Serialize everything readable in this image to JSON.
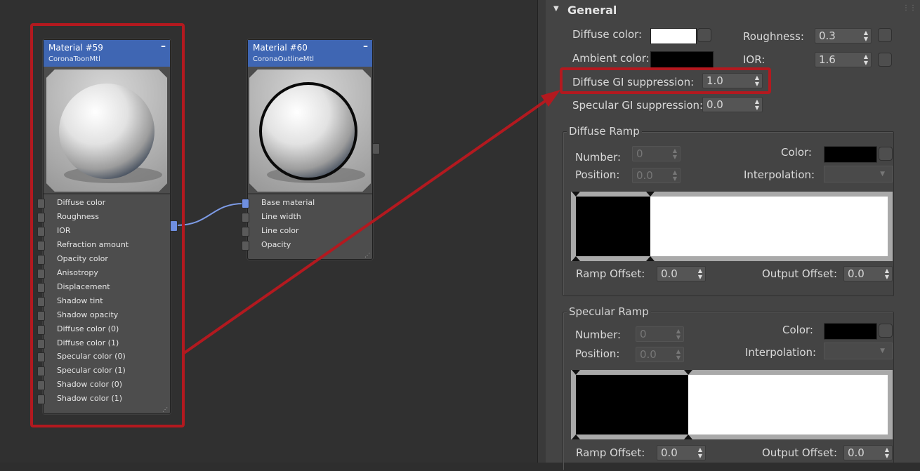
{
  "graph": {
    "nodes": [
      {
        "title": "Material #59",
        "subtitle": "CoronaToonMtl",
        "collapse_glyph": "–",
        "slots": [
          "Diffuse color",
          "Roughness",
          "IOR",
          "Refraction amount",
          "Opacity color",
          "Anisotropy",
          "Displacement",
          "Shadow tint",
          "Shadow opacity",
          "Diffuse color (0)",
          "Diffuse color (1)",
          "Specular color (0)",
          "Specular color (1)",
          "Shadow color (0)",
          "Shadow color (1)"
        ]
      },
      {
        "title": "Material #60",
        "subtitle": "CoronaOutlineMtl",
        "collapse_glyph": "–",
        "slots": [
          "Base material",
          "Line width",
          "Line color",
          "Opacity"
        ]
      }
    ]
  },
  "panel": {
    "rollout_title": "General",
    "diffuse_color_label": "Diffuse color:",
    "ambient_color_label": "Ambient color:",
    "roughness_label": "Roughness:",
    "roughness_value": "0.3",
    "ior_label": "IOR:",
    "ior_value": "1.6",
    "diffuse_gi_label": "Diffuse GI suppression:",
    "diffuse_gi_value": "1.0",
    "specular_gi_label": "Specular GI suppression:",
    "specular_gi_value": "0.0",
    "diffuse_ramp": {
      "title": "Diffuse Ramp",
      "number_label": "Number:",
      "number_value": "0",
      "position_label": "Position:",
      "position_value": "0.0",
      "color_label": "Color:",
      "interpolation_label": "Interpolation:",
      "ramp_offset_label": "Ramp Offset:",
      "ramp_offset_value": "0.0",
      "output_offset_label": "Output Offset:",
      "output_offset_value": "0.0"
    },
    "specular_ramp": {
      "title": "Specular Ramp",
      "number_label": "Number:",
      "number_value": "0",
      "position_label": "Position:",
      "position_value": "0.0",
      "color_label": "Color:",
      "interpolation_label": "Interpolation:",
      "ramp_offset_label": "Ramp Offset:",
      "ramp_offset_value": "0.0",
      "output_offset_label": "Output Offset:",
      "output_offset_value": "0.0"
    }
  },
  "colors": {
    "annotation_red": "#b3191f",
    "node_header_blue": "#3f66b3",
    "diffuse_swatch": "#ffffff",
    "ambient_swatch": "#000000",
    "ramp_color_swatch": "#000000"
  }
}
